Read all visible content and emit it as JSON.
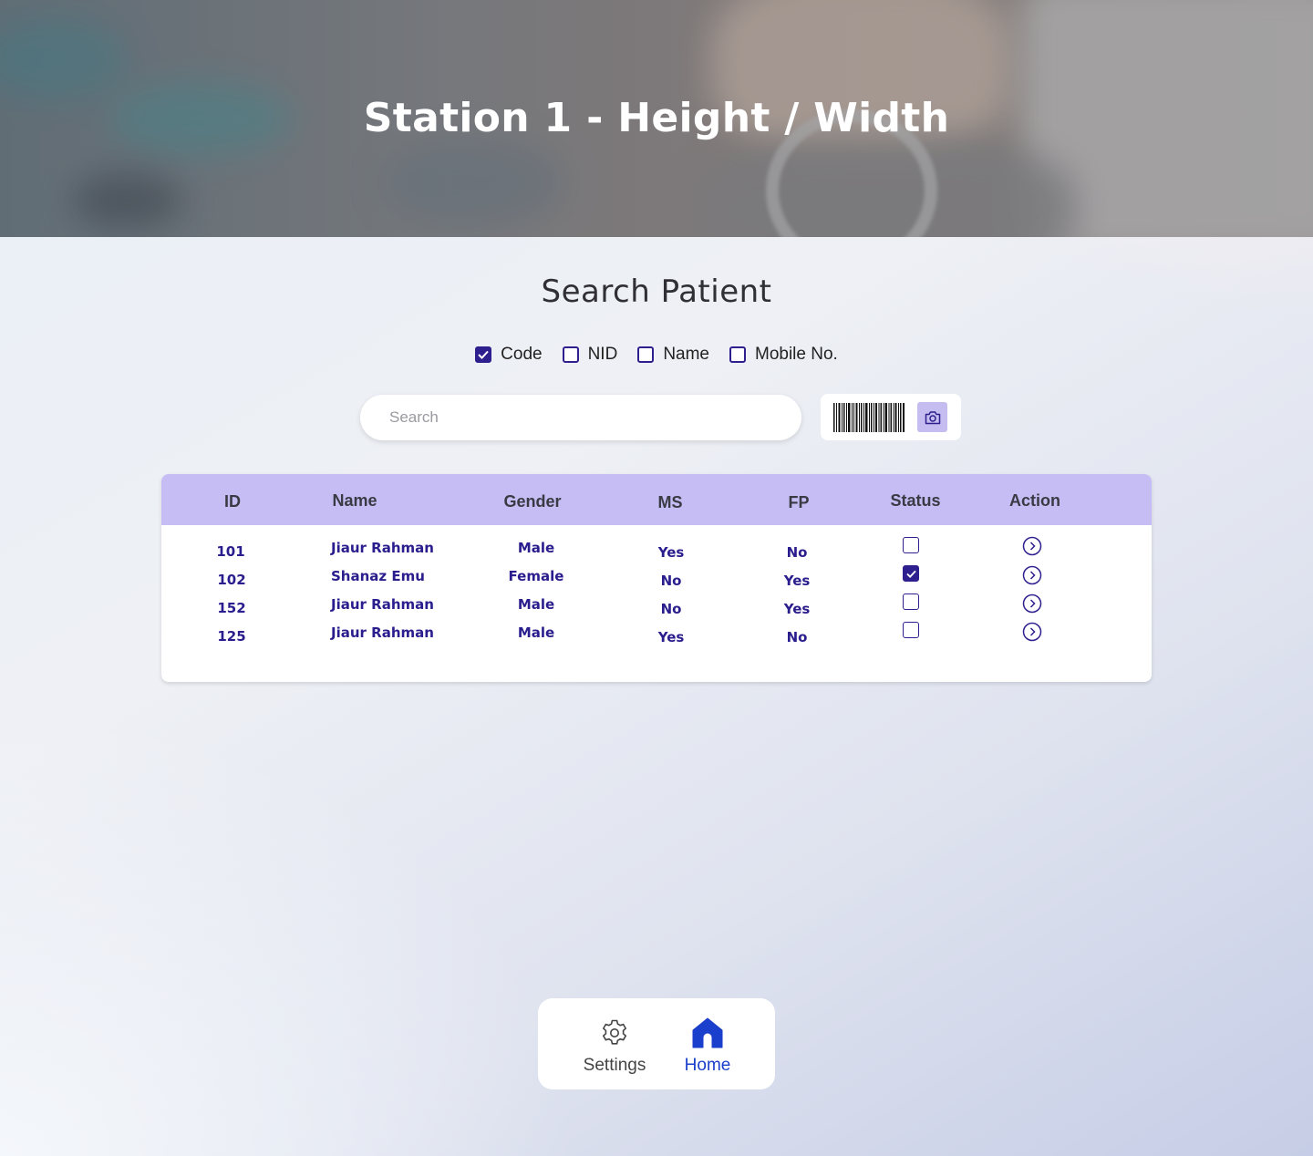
{
  "header": {
    "title": "Station 1 - Height / Width"
  },
  "search": {
    "title": "Search Patient",
    "filters": [
      {
        "label": "Code",
        "checked": true
      },
      {
        "label": "NID",
        "checked": false
      },
      {
        "label": "Name",
        "checked": false
      },
      {
        "label": "Mobile No.",
        "checked": false
      }
    ],
    "placeholder": "Search",
    "value": "",
    "barcode_icon": "barcode-icon",
    "camera_icon": "camera-icon"
  },
  "table": {
    "columns": [
      "ID",
      "Name",
      "Gender",
      "MS",
      "FP",
      "Status",
      "Action"
    ],
    "rows": [
      {
        "id": "101",
        "name": "Jiaur Rahman",
        "gender": "Male",
        "ms": "Yes",
        "fp": "No",
        "status": false
      },
      {
        "id": "102",
        "name": "Shanaz Emu",
        "gender": "Female",
        "ms": "No",
        "fp": "Yes",
        "status": true
      },
      {
        "id": "152",
        "name": "Jiaur Rahman",
        "gender": "Male",
        "ms": "No",
        "fp": "Yes",
        "status": false
      },
      {
        "id": "125",
        "name": "Jiaur Rahman",
        "gender": "Male",
        "ms": "Yes",
        "fp": "No",
        "status": false
      }
    ],
    "action_icon": "chevron-right-circle-icon"
  },
  "nav": {
    "settings": {
      "label": "Settings",
      "icon": "gear-icon",
      "color": "#444444"
    },
    "home": {
      "label": "Home",
      "icon": "home-icon",
      "color": "#1a3fcc",
      "active": true
    }
  },
  "colors": {
    "accent": "#2e1f8f",
    "table_header": "#c5bdf3",
    "nav_active": "#1a3fcc"
  }
}
